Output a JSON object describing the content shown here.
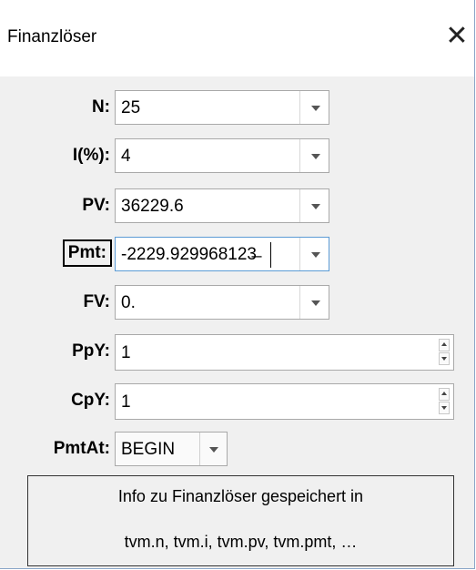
{
  "window": {
    "title": "Finanzlöser",
    "close_glyph": "✕"
  },
  "fields": {
    "n": {
      "label": "N:",
      "value": "25"
    },
    "i": {
      "label": "I(%):",
      "value": "4"
    },
    "pv": {
      "label": "PV:",
      "value": "36229.6"
    },
    "pmt": {
      "label": "Pmt:",
      "value": "-2229.929968123̶"
    },
    "fv": {
      "label": "FV:",
      "value": "0."
    },
    "ppy": {
      "label": "PpY:",
      "value": "1"
    },
    "cpy": {
      "label": "CpY:",
      "value": "1"
    },
    "pmtat": {
      "label": "PmtAt:",
      "value": "BEGIN"
    }
  },
  "info": {
    "line1": "Info zu Finanzlöser gespeichert in",
    "line2": "tvm.n, tvm.i, tvm.pv, tvm.pmt, …"
  }
}
